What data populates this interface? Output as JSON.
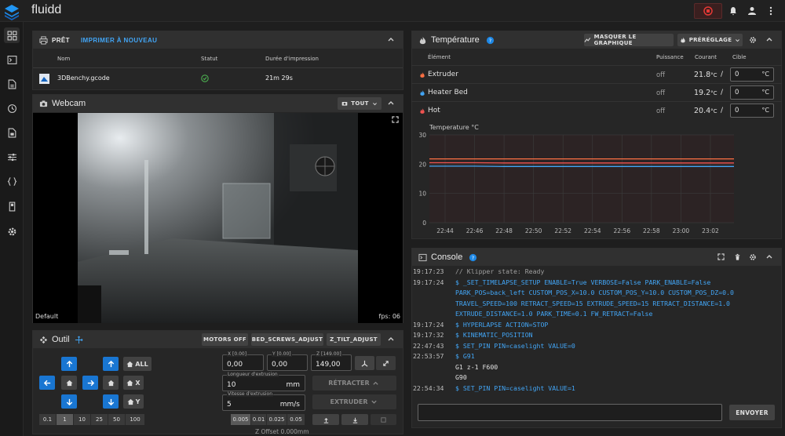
{
  "app": {
    "title": "fluidd"
  },
  "status_card": {
    "state": "PRÊT",
    "reprint_label": "IMPRIMER À NOUVEAU",
    "columns": [
      "Nom",
      "Statut",
      "Durée d'impression"
    ],
    "job": {
      "name": "3DBenchy.gcode",
      "duration": "21m 29s"
    }
  },
  "webcam": {
    "title": "Webcam",
    "filter_label": "TOUT",
    "camera_name": "Default",
    "fps": "fps: 06"
  },
  "tool": {
    "title": "Outil",
    "buttons": {
      "motors_off": "MOTORS OFF",
      "bed_screws": "BED_SCREWS_ADJUST",
      "z_tilt": "Z_TILT_ADJUST"
    },
    "home_all": "ALL",
    "home_x": "X",
    "home_y": "Y",
    "jog_steps": [
      "0.1",
      "1",
      "10",
      "25",
      "50",
      "100"
    ],
    "jog_selected": "1",
    "pos_x": {
      "label": "X [0.00]",
      "value": "0,00"
    },
    "pos_y": {
      "label": "Y [0.00]",
      "value": "0,00"
    },
    "pos_z": {
      "label": "Z [149.00]",
      "value": "149,00"
    },
    "extrude_length": {
      "label": "Longueur d'extrusion",
      "value": "10",
      "unit": "mm"
    },
    "extrude_speed": {
      "label": "Vitesse d'extrusion",
      "value": "5",
      "unit": "mm/s"
    },
    "retract_label": "RÉTRACTER",
    "extrude_label": "EXTRUDER",
    "z_steps": [
      "0.005",
      "0.01",
      "0.025",
      "0.05"
    ],
    "z_selected": "0.005",
    "z_offset": "Z Offset 0.000mm"
  },
  "temperature": {
    "title": "Température",
    "hide_chart_label": "MASQUER LE GRAPHIQUE",
    "preset_label": "PRÉRÉGLAGE",
    "columns": {
      "element": "Élément",
      "power": "Puissance",
      "current": "Courant",
      "target": "Cible"
    },
    "rows": [
      {
        "name": "Extruder",
        "power": "off",
        "current": "21.8",
        "unit": "°C",
        "target": "0",
        "color": "#ff7043"
      },
      {
        "name": "Heater Bed",
        "power": "off",
        "current": "19.2",
        "unit": "°C",
        "target": "0",
        "color": "#42a5f5"
      },
      {
        "name": "Hot",
        "power": "off",
        "current": "20.4",
        "unit": "°C",
        "target": "0",
        "color": "#ef5350"
      }
    ],
    "slash": "/",
    "target_unit": "°C"
  },
  "chart_data": {
    "type": "line",
    "ylabel": "Temperature °C",
    "ylim": [
      0,
      30
    ],
    "yticks": [
      "30",
      "20",
      "10",
      "0"
    ],
    "x": [
      "22:44",
      "22:46",
      "22:48",
      "22:50",
      "22:52",
      "22:54",
      "22:56",
      "22:58",
      "23:00",
      "23:02"
    ],
    "series": [
      {
        "name": "Extruder",
        "color": "#ff7043",
        "values": [
          21.8,
          21.8,
          21.8,
          21.8,
          21.8,
          21.8,
          21.8,
          21.8,
          21.8,
          21.8
        ]
      },
      {
        "name": "Hot",
        "color": "#ef5350",
        "values": [
          20.5,
          20.5,
          20.4,
          20.4,
          20.4,
          20.4,
          20.4,
          20.4,
          20.4,
          20.4
        ]
      },
      {
        "name": "Heater Bed",
        "color": "#42a5f5",
        "values": [
          19.3,
          19.3,
          19.2,
          19.2,
          19.2,
          19.2,
          19.2,
          19.2,
          19.2,
          19.2
        ]
      }
    ],
    "grid": true
  },
  "console": {
    "title": "Console",
    "send_label": "ENVOYER",
    "lines": [
      {
        "time": "19:17:23",
        "text": "// Klipper state: Ready",
        "kind": "comment"
      },
      {
        "time": "19:17:24",
        "text": "$ _SET_TIMELAPSE_SETUP ENABLE=True VERBOSE=False PARK_ENABLE=False",
        "kind": "cmd"
      },
      {
        "time": "",
        "text": "PARK_POS=back_left CUSTOM_POS_X=10.0 CUSTOM_POS_Y=10.0 CUSTOM_POS_DZ=0.0",
        "kind": "cmd"
      },
      {
        "time": "",
        "text": "TRAVEL_SPEED=100 RETRACT_SPEED=15 EXTRUDE_SPEED=15 RETRACT_DISTANCE=1.0",
        "kind": "cmd"
      },
      {
        "time": "",
        "text": "EXTRUDE_DISTANCE=1.0 PARK_TIME=0.1 FW_RETRACT=False",
        "kind": "cmd"
      },
      {
        "time": "19:17:24",
        "text": "$ HYPERLAPSE ACTION=STOP",
        "kind": "cmd"
      },
      {
        "time": "19:17:32",
        "text": "$ KINEMATIC_POSITION",
        "kind": "cmd"
      },
      {
        "time": "22:47:43",
        "text": "$ SET_PIN PIN=caselight VALUE=0",
        "kind": "cmd"
      },
      {
        "time": "22:53:57",
        "text": "$ G91",
        "kind": "cmd"
      },
      {
        "time": "",
        "text": "G1 z-1 F600",
        "kind": "plain"
      },
      {
        "time": "",
        "text": "G90",
        "kind": "plain"
      },
      {
        "time": "22:54:34",
        "text": "$ SET_PIN PIN=caselight VALUE=1",
        "kind": "cmd"
      }
    ]
  },
  "icons": {
    "logo": "fluidd-layers-logo",
    "sidebar": [
      "dashboard-icon",
      "console-icon",
      "files-icon",
      "history-icon",
      "jobs-icon",
      "tune-icon",
      "macros-icon",
      "system-icon",
      "settings-icon"
    ]
  },
  "colors": {
    "accent": "#1976d2",
    "link": "#42a5f5",
    "danger": "#e53935"
  }
}
